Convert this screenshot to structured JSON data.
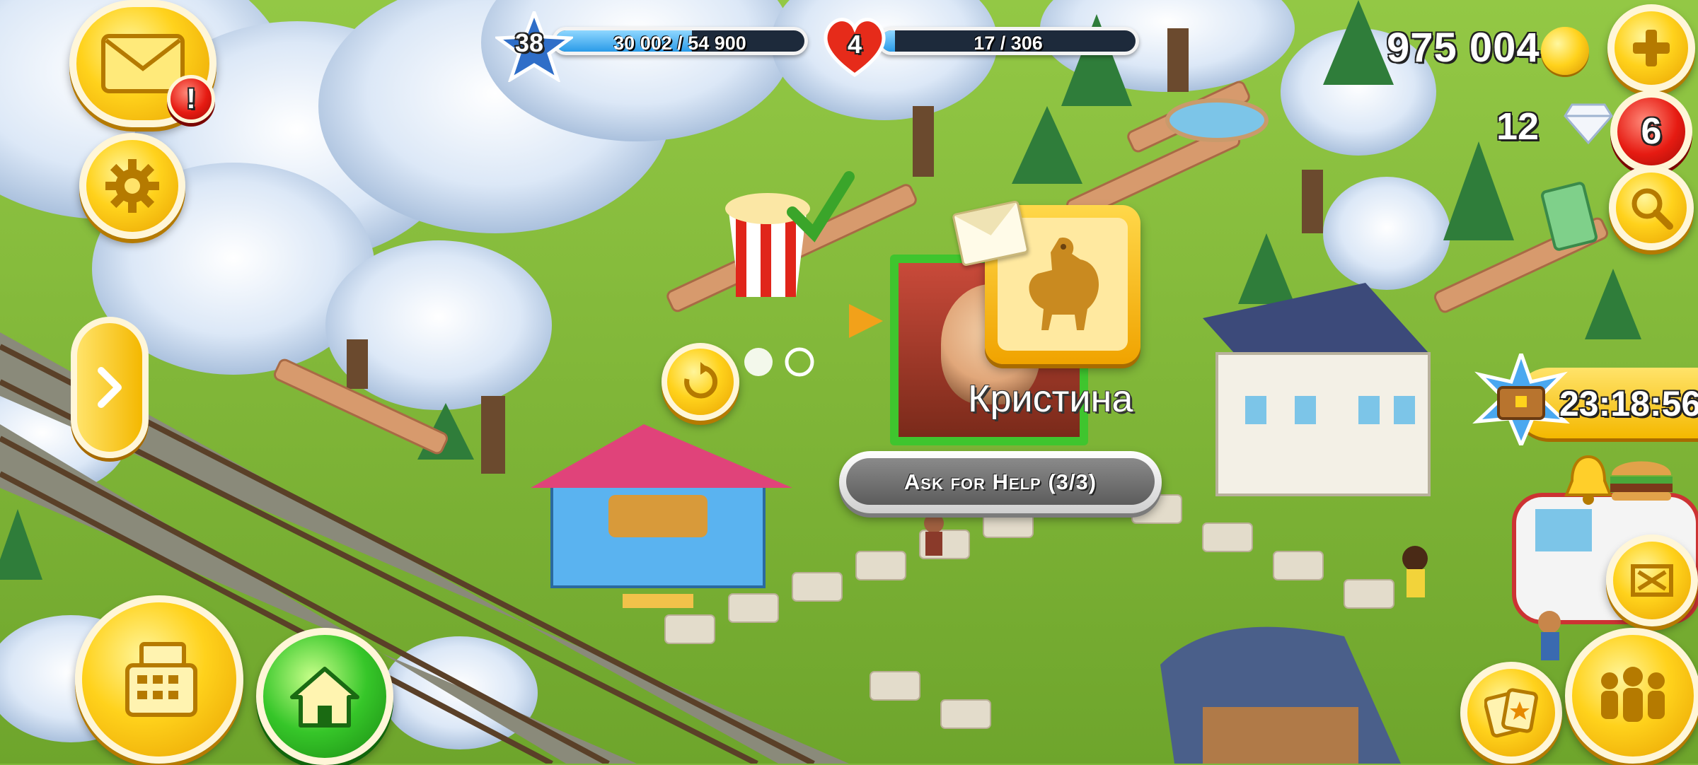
{
  "hud": {
    "level": "38",
    "xp_text": "30 002 / 54 900",
    "xp_progress": 0.547,
    "reputation_level": "4",
    "reputation_text": "17 / 306",
    "reputation_progress": 0.056,
    "coins": "975 004",
    "diamonds": "12",
    "notifications_count": "6",
    "mail_alert": "!",
    "event_timer": "23:18:56"
  },
  "popup": {
    "player_name": "Кристина",
    "ask_help_label": "Ask for Help (3/3)"
  },
  "icons": {
    "mail": "envelope-icon",
    "settings": "gear-icon",
    "expand": "chevron-right-icon",
    "shop": "cash-register-icon",
    "home": "house-icon",
    "add_coins": "plus-icon",
    "search": "magnifier-icon",
    "friends": "people-icon",
    "fullscreen": "expand-arrows-icon",
    "cards": "cards-icon",
    "chest": "treasure-chest-icon"
  },
  "colors": {
    "grass": "#7fb83a",
    "gold": "#ffd21c",
    "bar_fill": "#2a9be8",
    "alert_red": "#e61b12"
  }
}
